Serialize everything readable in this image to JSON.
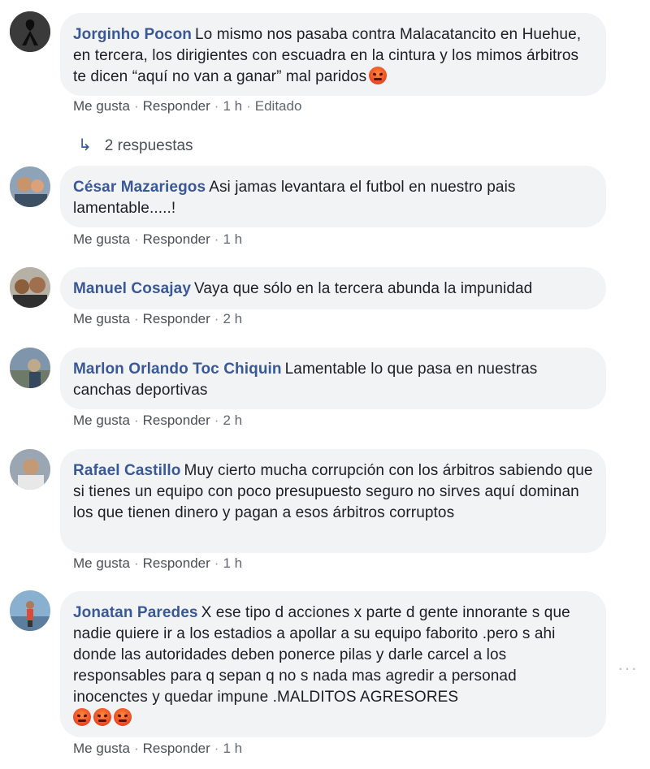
{
  "comments": [
    {
      "author": "Jorginho Pocon",
      "text": "Lo mismo nos pasaba contra Malacatancito en Huehue, en tercera, los dirigientes con escuadra en la cintura y los mimos árbitros te dicen “aquí no van a ganar” mal paridos",
      "like": "Me gusta",
      "reply": "Responder",
      "time": "1 h",
      "edited": "Editado",
      "replies": "2 respuestas",
      "emoji_count": 1
    },
    {
      "author": "César Mazariegos",
      "text": "Asi jamas levantara el futbol en nuestro pais lamentable.....!",
      "like": "Me gusta",
      "reply": "Responder",
      "time": "1 h"
    },
    {
      "author": "Manuel Cosajay",
      "text": "Vaya que sólo en la tercera abunda la impunidad",
      "like": "Me gusta",
      "reply": "Responder",
      "time": "2 h"
    },
    {
      "author": "Marlon Orlando Toc Chiquin",
      "text": "Lamentable lo que pasa en nuestras canchas deportivas",
      "like": "Me gusta",
      "reply": "Responder",
      "time": "2 h"
    },
    {
      "author": "Rafael Castillo",
      "text": "Muy cierto mucha corrupción con los árbitros sabiendo que si tienes un equipo con poco presupuesto seguro no sirves aquí dominan los que tienen dinero y pagan a esos árbitros corruptos",
      "like": "Me gusta",
      "reply": "Responder",
      "time": "1 h"
    },
    {
      "author": "Jonatan Paredes",
      "text": "X ese tipo d acciones x parte d gente innorante s que nadie quiere ir a los estadios a apollar a su equipo faborito .pero s ahi donde las autoridades deben ponerce pilas y darle carcel a los responsables para q sepan q no s nada mas agredir a personad inocenctes y quedar impune .MALDITOS AGRESORES",
      "like": "Me gusta",
      "reply": "Responder",
      "time": "1 h",
      "emoji_count": 3
    }
  ],
  "more_options": "···",
  "icons": {
    "reply_arrow": "reply-arrow-icon",
    "emoji": "angry-face-emoji-icon"
  },
  "colors": {
    "author": "#385898",
    "bubble": "#f2f3f5",
    "meta": "#606770"
  }
}
